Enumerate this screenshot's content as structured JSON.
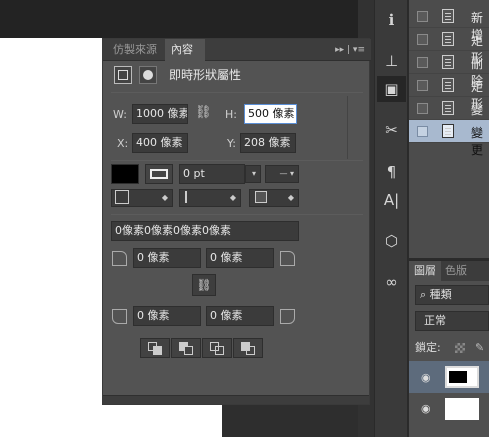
{
  "panel": {
    "tabs": {
      "adjustments": "仿製來源",
      "properties": "內容"
    },
    "menu_glyph": "▸▸ | ▾≡",
    "title": "即時形狀屬性",
    "w_label": "W:",
    "w_value": "1000 像素",
    "h_label": "H:",
    "h_value": "500 像素",
    "x_label": "X:",
    "x_value": "400 像素",
    "y_label": "Y:",
    "y_value": "208 像素",
    "stroke_width": "0 pt",
    "corner_values": "0像素0像素0像素0像素",
    "tl": "0 像素",
    "tr": "0 像素",
    "bl": "0 像素",
    "br": "0 像素"
  },
  "history": {
    "items": [
      {
        "label": "新增"
      },
      {
        "label": "矩形"
      },
      {
        "label": "刪除"
      },
      {
        "label": "矩形"
      },
      {
        "label": "變更"
      },
      {
        "label": "變更"
      }
    ]
  },
  "layers": {
    "tabs": {
      "layers": "圖層",
      "channels": "色版"
    },
    "filter_label": "種類",
    "blend_mode": "正常",
    "lock_label": "鎖定:"
  },
  "colors": {
    "panel": "#535353",
    "selected_history": "#a8b9cf"
  }
}
